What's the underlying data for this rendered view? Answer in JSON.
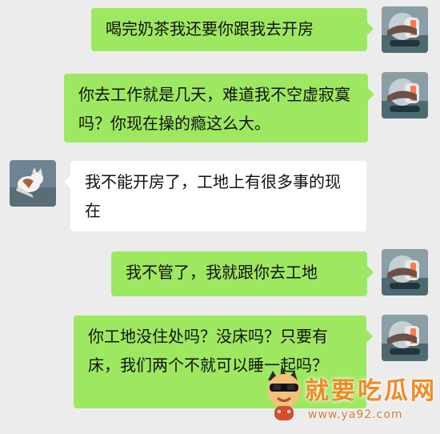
{
  "messages": [
    {
      "side": "right",
      "text": "喝完奶茶我还要你跟我去开房"
    },
    {
      "side": "right",
      "text": "你去工作就是几天，难道我不空虚寂寞吗？你现在操的瘾这么大。"
    },
    {
      "side": "left",
      "text": "我不能开房了，工地上有很多事的现在"
    },
    {
      "side": "right",
      "text": "我不管了，我就跟你去工地"
    },
    {
      "side": "right",
      "text": "你工地没住处吗？没床吗？只要有床，我们两个不就可以睡一起吗？"
    }
  ],
  "watermark": {
    "brand": "就要吃瓜网",
    "url": "www.ya92.com"
  },
  "colors": {
    "background": "#ececec",
    "bubble_self": "#9ee861",
    "bubble_other": "#ffffff",
    "watermark": "#f08a24"
  }
}
